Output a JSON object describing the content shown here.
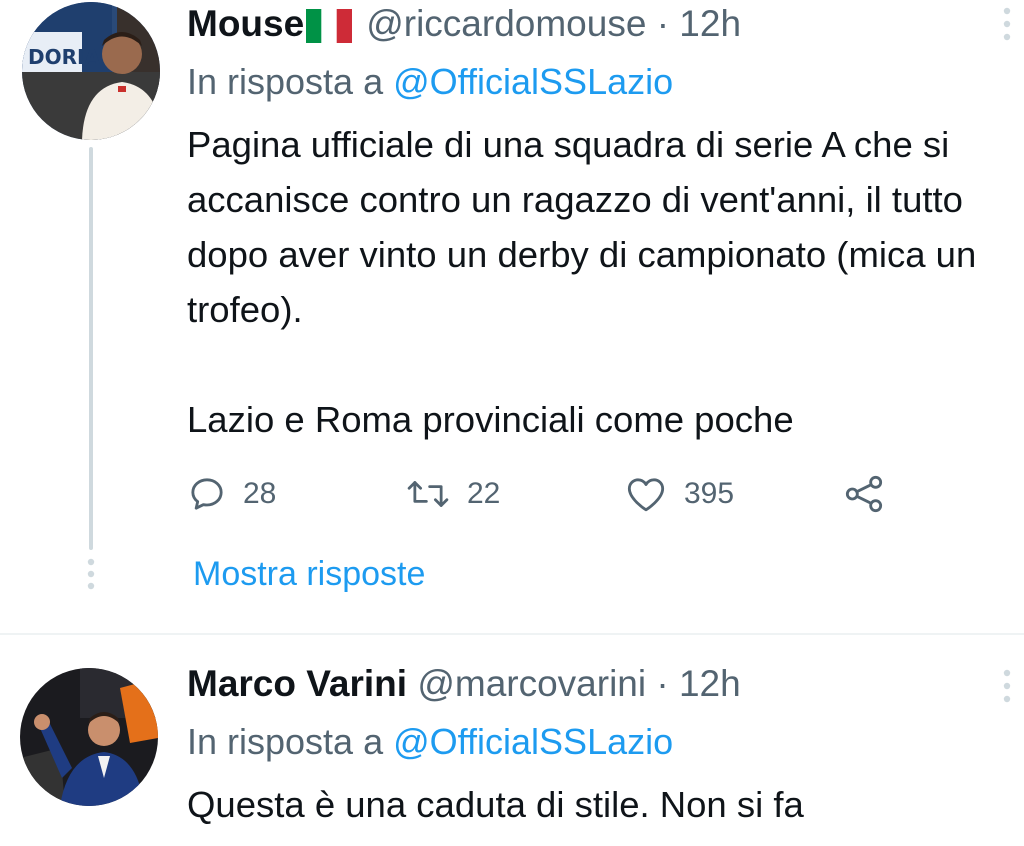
{
  "tweets": [
    {
      "author_name": "Mouse",
      "author_flag": "italian-flag-icon",
      "handle": "@riccardomouse",
      "separator": "·",
      "time": "12h",
      "reply_prefix": "In risposta a",
      "reply_mention": "@OfficialSSLazio",
      "text": "Pagina ufficiale di una squadra di serie A che si accanisce contro un ragazzo di vent'anni, il tutto dopo aver vinto un derby di campionato (mica un trofeo).\n\nLazio e Roma provinciali come poche",
      "stats": {
        "replies": "28",
        "retweets": "22",
        "likes": "395"
      },
      "show_replies_label": "Mostra risposte"
    },
    {
      "author_name": "Marco Varini",
      "handle": "@marcovarini",
      "separator": "·",
      "time": "12h",
      "reply_prefix": "In risposta a",
      "reply_mention": "@OfficialSSLazio",
      "text": "Questa è una caduta di stile. Non si fa"
    }
  ],
  "icons": {
    "reply": "reply-icon",
    "retweet": "retweet-icon",
    "like": "heart-icon",
    "share": "share-icon",
    "more": "more-vertical-icon"
  },
  "colors": {
    "accent": "#1d9bf0",
    "secondary_text": "#536471",
    "primary_text": "#0f1419",
    "thread_line": "#cfd9de",
    "divider": "#eff3f4"
  }
}
